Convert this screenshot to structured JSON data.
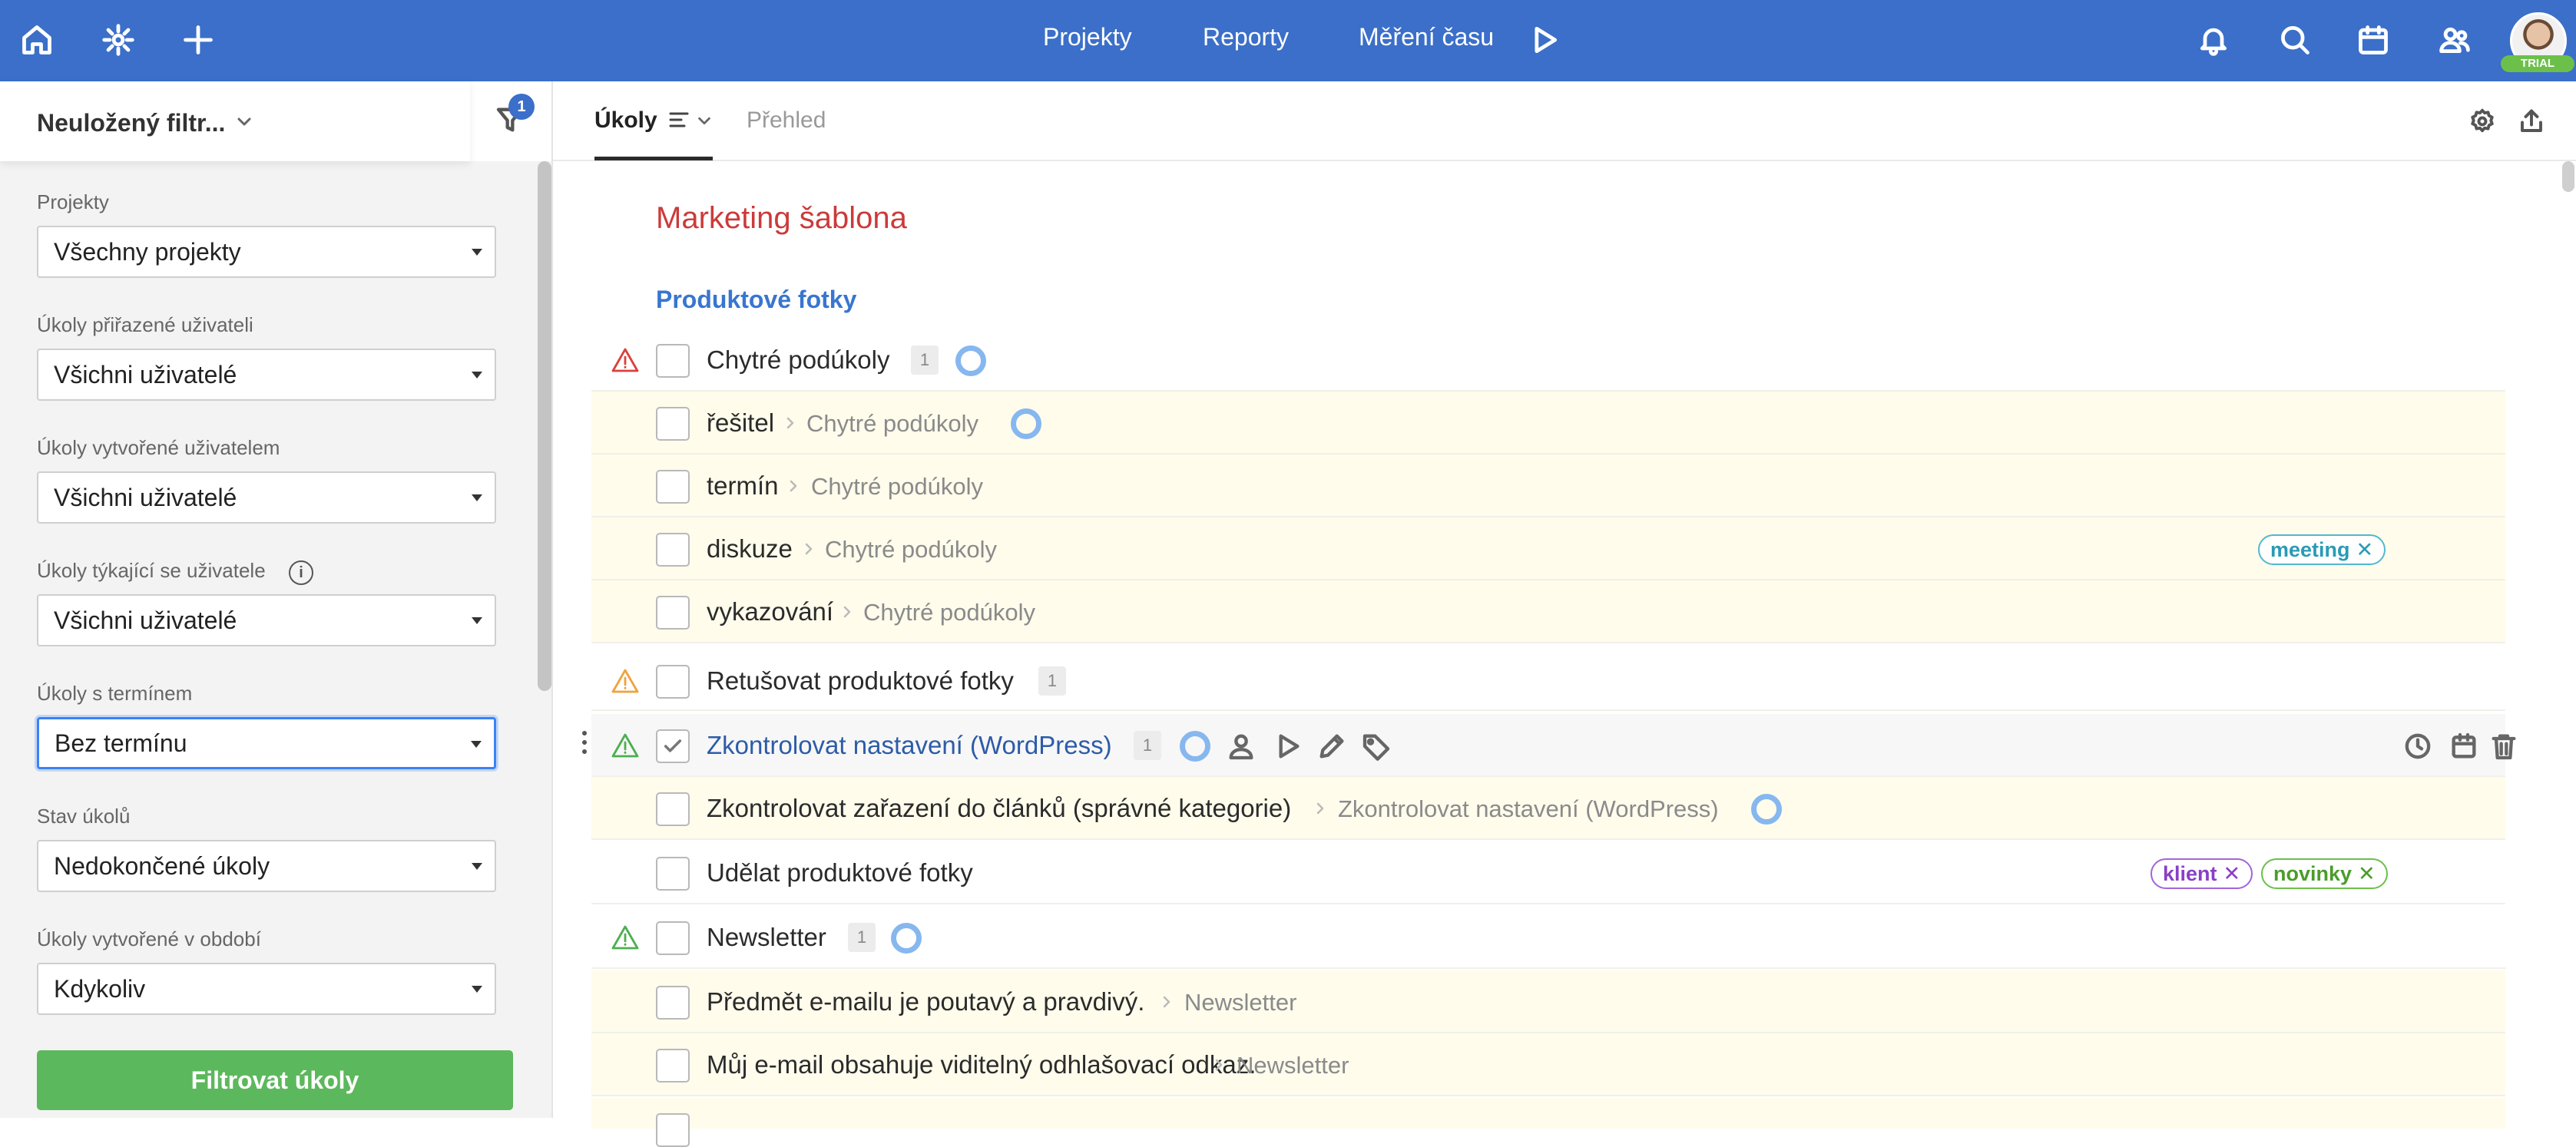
{
  "topbar": {
    "nav": [
      "Projekty",
      "Reporty",
      "Měření času"
    ],
    "icons": [
      "home-icon",
      "settings-icon",
      "plus-icon",
      "play-icon",
      "bell-icon",
      "search-icon",
      "calendar-icon",
      "users-icon"
    ],
    "trial_badge": "TRIAL",
    "accent_color": "#3b6fc9"
  },
  "sidebar": {
    "filter_name": "Neuložený filtr...",
    "filter_badge": "1",
    "fields": [
      {
        "label": "Projekty",
        "value": "Všechny projekty"
      },
      {
        "label": "Úkoly přiřazené uživateli",
        "value": "Všichni uživatelé"
      },
      {
        "label": "Úkoly vytvořené uživatelem",
        "value": "Všichni uživatelé"
      },
      {
        "label": "Úkoly týkající se uživatele",
        "value": "Všichni uživatelé"
      },
      {
        "label": "Úkoly s termínem",
        "value": "Bez termínu"
      },
      {
        "label": "Stav úkolů",
        "value": "Nedokončené úkoly"
      },
      {
        "label": "Úkoly vytvořené v období",
        "value": "Kdykoliv"
      }
    ],
    "info_glyph": "i",
    "filter_button": "Filtrovat úkoly"
  },
  "tabs": {
    "active": "Úkoly",
    "inactive": "Přehled"
  },
  "main": {
    "project_title": "Marketing šablona",
    "section_title": "Produktové fotky",
    "rows": [
      {
        "name": "Chytré podúkoly",
        "count": "1",
        "warning": "red"
      },
      {
        "name": "řešitel",
        "parent": "Chytré podúkoly"
      },
      {
        "name": "termín",
        "parent": "Chytré podúkoly"
      },
      {
        "name": "diskuze",
        "parent": "Chytré podúkoly",
        "tags": [
          "meeting"
        ]
      },
      {
        "name": "vykazování",
        "parent": "Chytré podúkoly"
      },
      {
        "name": "Retušovat produktové fotky",
        "count": "1",
        "warning": "orange"
      },
      {
        "name": "Zkontrolovat nastavení (WordPress)",
        "count": "1",
        "warning": "green",
        "checked": true
      },
      {
        "name": "Zkontrolovat zařazení do článků (správné kategorie)",
        "parent": "Zkontrolovat nastavení (WordPress)"
      },
      {
        "name": "Udělat produktové fotky",
        "tags": [
          "klient",
          "novinky"
        ]
      },
      {
        "name": "Newsletter",
        "count": "1",
        "warning": "green"
      },
      {
        "name": "Předmět e-mailu je poutavý a pravdivý.",
        "parent": "Newsletter"
      },
      {
        "name": "Můj e-mail obsahuje viditelný odhlašovací odkaz.",
        "parent": "Newsletter"
      }
    ],
    "tag_close": "✕",
    "colors": {
      "warning_red": "#d9413b",
      "warning_orange": "#f0a23a",
      "warning_green": "#4caf50",
      "progress_ring": "#86b7ef"
    }
  }
}
